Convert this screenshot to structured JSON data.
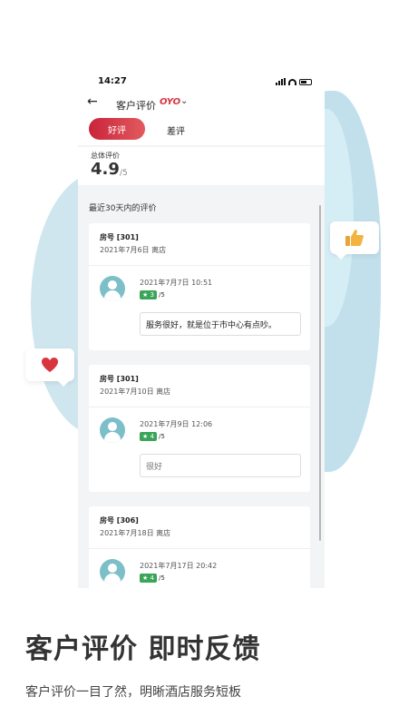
{
  "status_bar": {
    "time": "14:27"
  },
  "nav": {
    "back_icon": "back-arrow-icon",
    "title": "客户评价",
    "brand": "OYO",
    "chevron": "⌄"
  },
  "tabs": {
    "good": "好评",
    "bad": "差评"
  },
  "score": {
    "label": "总体评价",
    "value": "4.9",
    "denominator": "/5"
  },
  "section_title": "最近30天内的评价",
  "reviews": [
    {
      "room": "房号 [301]",
      "checkout": "2021年7月6日 离店",
      "review_time": "2021年7月7日 10:51",
      "stars": "★ 3",
      "star_denominator": "/5",
      "comment": "服务很好，就是位于市中心有点吵。"
    },
    {
      "room": "房号 [301]",
      "checkout": "2021年7月10日 离店",
      "review_time": "2021年7月9日 12:06",
      "stars": "★ 4",
      "star_denominator": "/5",
      "comment": "很好"
    },
    {
      "room": "房号 [306]",
      "checkout": "2021年7月18日 离店",
      "review_time": "2021年7月17日 20:42",
      "stars": "★ 4",
      "star_denominator": "/5",
      "comment": ""
    }
  ],
  "promo": {
    "headline": "客户评价 即时反馈",
    "subline": "客户评价一目了然，明晰酒店服务短板"
  },
  "colors": {
    "accent": "#d8353f",
    "star_badge": "#3aa557",
    "avatar": "#7cbfc9",
    "blob": "#c2e0ec"
  }
}
